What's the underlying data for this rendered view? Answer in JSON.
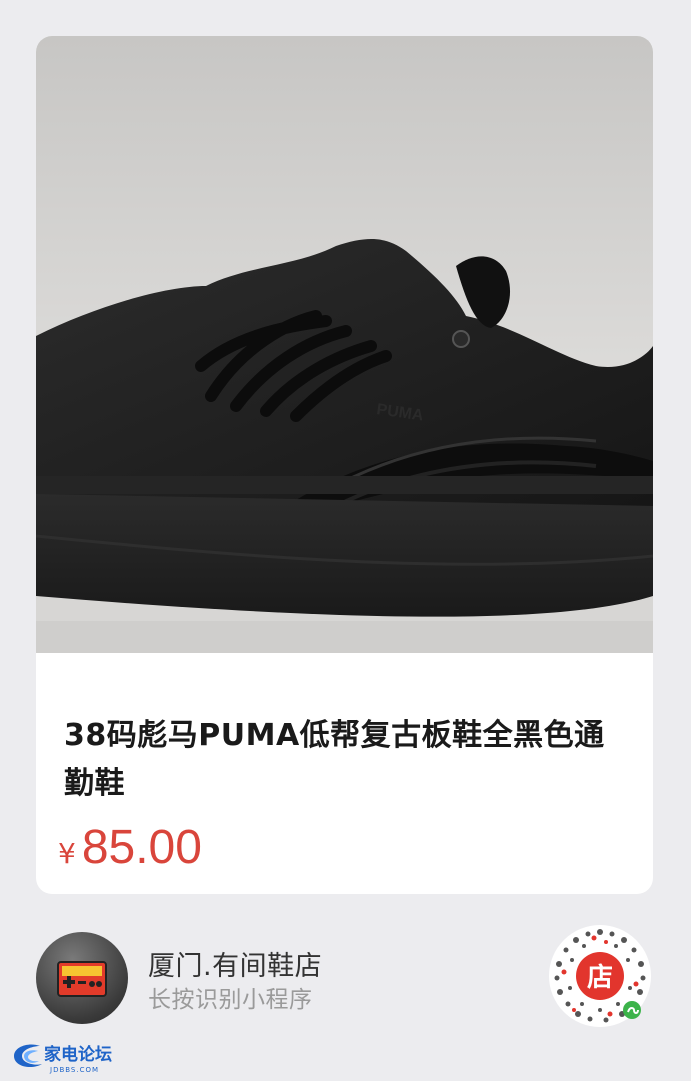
{
  "product": {
    "title": "38码彪马PUMA低帮复古板鞋全黑色通勤鞋",
    "price_currency": "¥",
    "price_amount": "85.00",
    "image_logo_text": "PUMA"
  },
  "shop": {
    "name": "厦门.有间鞋店",
    "hint": "长按识别小程序",
    "avatar_icon": "game-controller-icon",
    "qr_center_text": "店"
  },
  "watermark": {
    "name": "家电论坛",
    "domain": "JDBBS.COM"
  },
  "colors": {
    "price": "#d9453b",
    "background": "#ececef",
    "card": "#ffffff",
    "qr_accent": "#e2352d",
    "watermark_blue": "#1f64c8"
  }
}
